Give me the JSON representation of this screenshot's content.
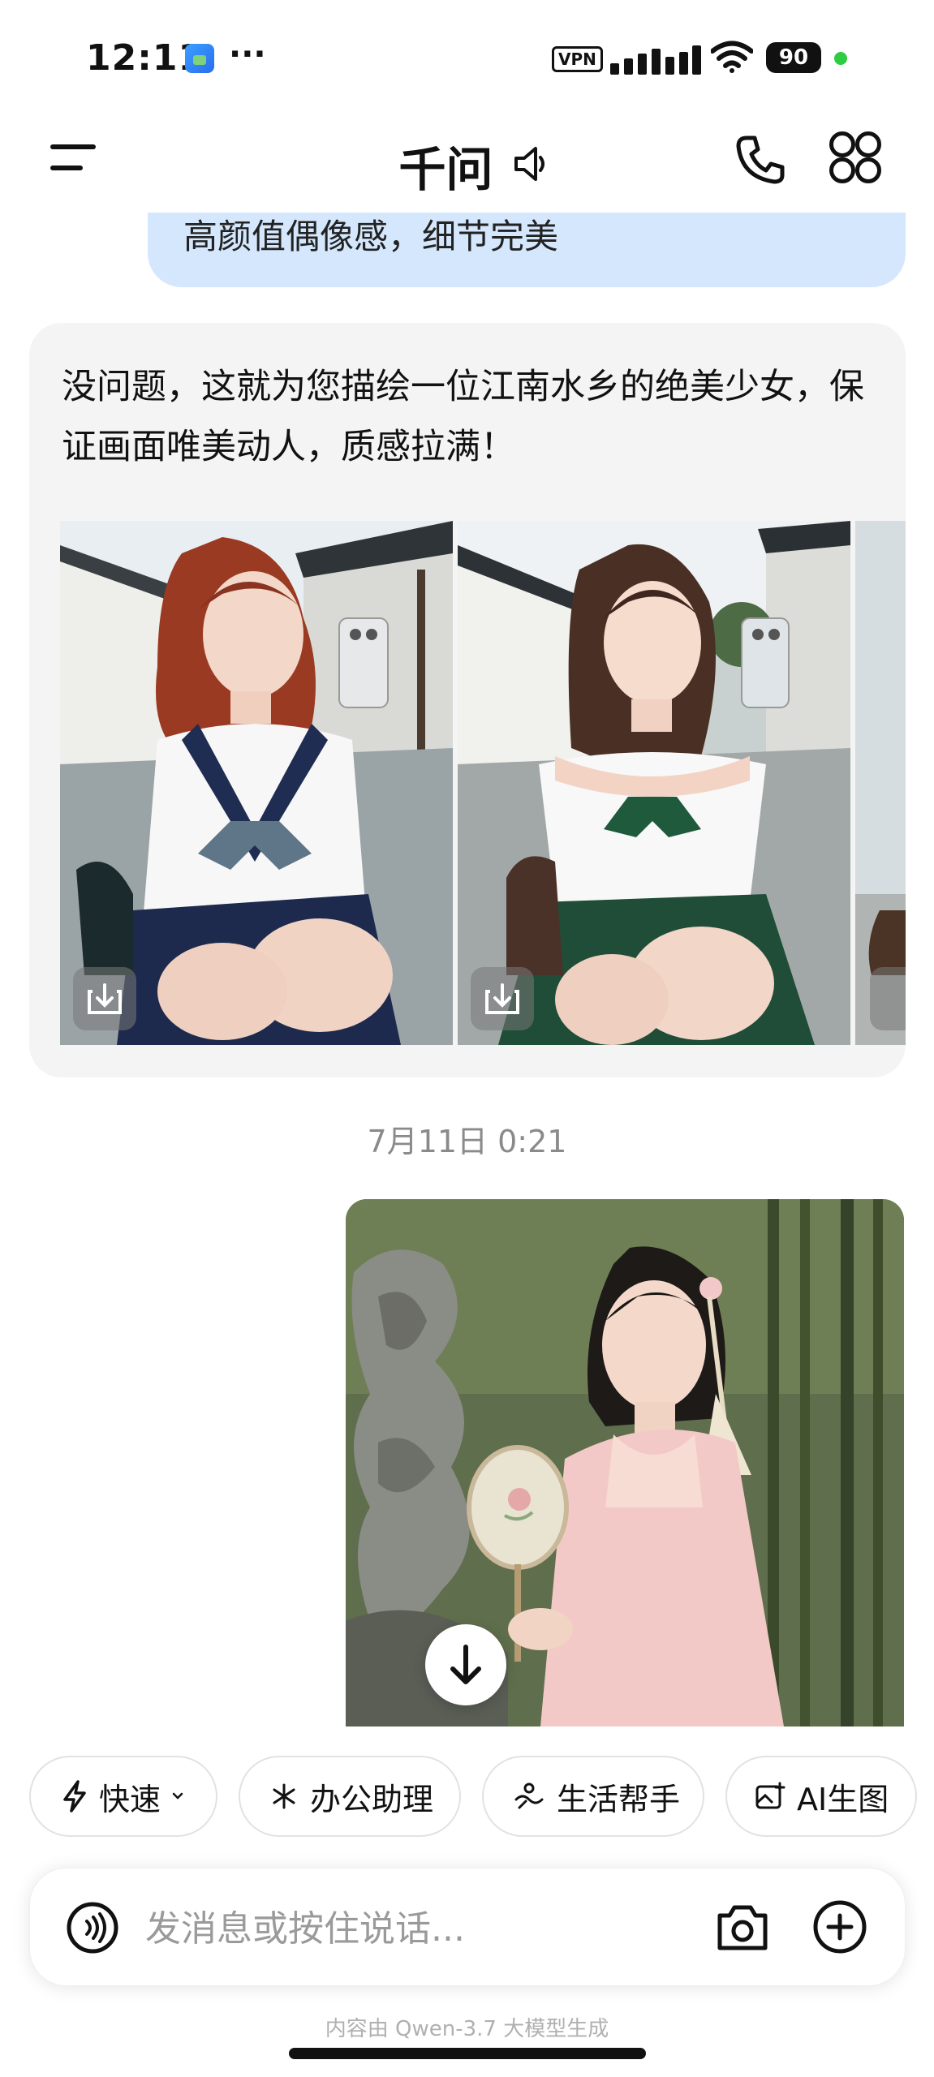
{
  "status_bar": {
    "time": "12:11",
    "more": "···",
    "vpn": "VPN",
    "battery": "90"
  },
  "header": {
    "title": "千问"
  },
  "chat": {
    "user_message_partial": "高颜值偶像感，细节完美",
    "ai_reply": "没问题，这就为您描绘一位江南水乡的绝美少女，保证画面唯美动人，质感拉满！",
    "timestamp": "7月11日 0:21"
  },
  "chips": [
    {
      "label": "快速",
      "icon": "lightning-icon"
    },
    {
      "label": "办公助理",
      "icon": "sparkle-icon"
    },
    {
      "label": "生活帮手",
      "icon": "wave-icon"
    },
    {
      "label": "AI生图",
      "icon": "image-plus-icon"
    }
  ],
  "input": {
    "placeholder": "发消息或按住说话..."
  },
  "footer": {
    "note": "内容由 Qwen-3.7 大模型生成"
  },
  "colors": {
    "user_bubble": "#d4e7fd",
    "ai_card": "#f4f4f4",
    "accent_text": "#111111"
  }
}
